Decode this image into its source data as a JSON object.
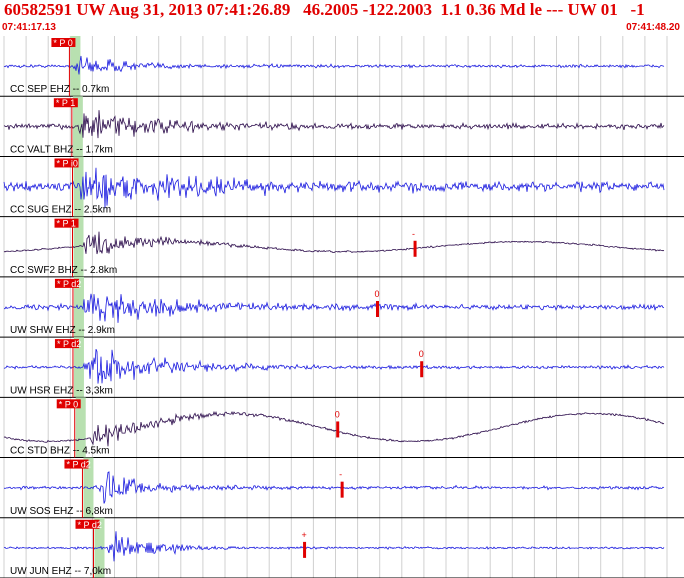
{
  "header": {
    "title": "60582591 UW Aug 31, 2013 07:41:26.89   46.2005 -122.2003  1.1 0.36 Md le --- UW 01   -1",
    "start_time": "07:41:17.13",
    "end_time": "07:41:48.20"
  },
  "colors": {
    "title": "#e00000",
    "trace_blue": "#1a1adf",
    "trace_dark": "#2a0a4a",
    "pick": "#e00000",
    "pick_window": "#b8e0b0",
    "grid": "#d0d0d0",
    "divider": "#000000"
  },
  "traces": [
    {
      "label": "CC SEP EHZ -- 0.7km",
      "pick_label": "P 0",
      "color": "blue",
      "pick_time": 2.96,
      "onset": 3.1,
      "decay": 2.2,
      "amp": 0.45,
      "noise": 0.06,
      "wave": 0,
      "coda_end": 29.0
    },
    {
      "label": "CC VALT BHZ -- 1.7km",
      "pick_label": "P 1",
      "color": "dark",
      "pick_time": 3.07,
      "onset": 3.3,
      "decay": 3.5,
      "amp": 0.62,
      "noise": 0.1,
      "wave": 0,
      "coda_end": 29.0
    },
    {
      "label": "CC SUG EHZ -- 2.5km",
      "pick_label": "P i0",
      "color": "blue",
      "pick_time": 3.1,
      "onset": 3.4,
      "decay": 4.5,
      "amp": 0.72,
      "noise": 0.18,
      "wave": 0,
      "coda_end": 29.0,
      "tail": 1
    },
    {
      "label": "CC SWF2 BHZ -- 2.8km",
      "pick_label": "P 1",
      "color": "dark",
      "pick_time": 3.1,
      "onset": 3.5,
      "decay": 2.8,
      "amp": 0.55,
      "noise": 0.03,
      "wave": 0.2,
      "coda_end": 29.0,
      "marker_label": "-",
      "marker_time": 18.6
    },
    {
      "label": "UW SHW EHZ -- 2.9km",
      "pick_label": "P d2",
      "color": "blue",
      "pick_time": 3.12,
      "onset": 3.55,
      "decay": 3.2,
      "amp": 0.8,
      "noise": 0.1,
      "wave": 0,
      "coda_end": 29.0,
      "marker_label": "0",
      "marker_time": 16.9
    },
    {
      "label": "UW HSR EHZ -- 3,3km",
      "pick_label": "P d2",
      "color": "blue",
      "pick_time": 3.12,
      "onset": 3.6,
      "decay": 3.0,
      "amp": 0.8,
      "noise": 0.06,
      "wave": 0,
      "coda_end": 29.0,
      "marker_label": "0",
      "marker_time": 18.9
    },
    {
      "label": "CC STD BHZ -- 4.5km",
      "pick_label": "P 0",
      "color": "dark",
      "pick_time": 3.2,
      "onset": 3.9,
      "decay": 2.6,
      "amp": 0.55,
      "noise": 0.04,
      "wave": 0.55,
      "coda_end": 29.0,
      "marker_label": "0",
      "marker_time": 15.1
    },
    {
      "label": "UW SOS EHZ -- 6,8km",
      "pick_label": "P d2",
      "color": "blue",
      "pick_time": 3.55,
      "onset": 4.2,
      "decay": 2.0,
      "amp": 0.75,
      "noise": 0.06,
      "wave": 0,
      "coda_end": 29.0,
      "marker_label": "-",
      "marker_time": 15.3
    },
    {
      "label": "UW JUN EHZ -- 7,0km",
      "pick_label": "P d2",
      "color": "blue",
      "pick_time": 4.05,
      "onset": 4.6,
      "decay": 1.8,
      "amp": 0.7,
      "noise": 0.04,
      "wave": 0,
      "coda_end": 29.0,
      "marker_label": "+",
      "marker_time": 13.6
    }
  ]
}
